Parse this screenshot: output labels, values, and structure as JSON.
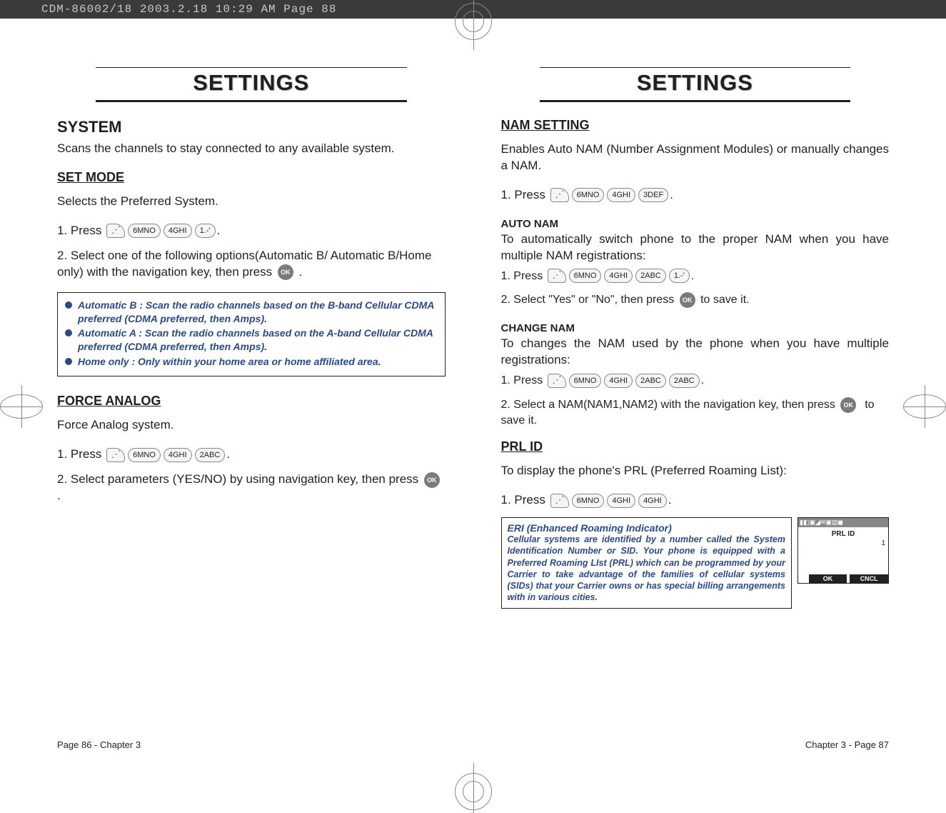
{
  "crop_bar": "CDM-86002/18  2003.2.18  10:29 AM  Page 88",
  "left": {
    "title": "SETTINGS",
    "h2": "SYSTEM",
    "intro": "Scans the channels to stay connected to any available system.",
    "setmode": {
      "heading": "SET MODE",
      "desc": "Selects the Preferred System."
    },
    "step1": {
      "pre": "1. Press",
      "post": "."
    },
    "step2": "2. Select one of the following options(Automatic B/ Automatic B/Home only) with the navigation key, then press",
    "step2_post": ".",
    "keys": {
      "k1": "6MNO",
      "k2": "4GHI",
      "k3": "1.-'"
    },
    "ok": "OK",
    "callout": {
      "b_label": "Automatic B :",
      "b_desc": "Scan the radio channels based on the B-band Cellular CDMA preferred (CDMA preferred, then Amps).",
      "a_label": "Automatic A :",
      "a_desc": "Scan the radio channels based on the A-band Cellular CDMA preferred (CDMA preferred, then Amps).",
      "h_label": "Home only :",
      "h_desc": "Only within your home area or home affiliated area."
    },
    "force": {
      "heading": "FORCE ANALOG",
      "desc": "Force Analog system."
    },
    "fstep1": {
      "pre": "1. Press",
      "post": "."
    },
    "fkeys": {
      "k1": "6MNO",
      "k2": "4GHI",
      "k3": "2ABC"
    },
    "fstep2": {
      "pre": "2. Select parameters (YES/NO) by using navigation key, then press",
      "post": "."
    },
    "footer": "Page 86 - Chapter 3"
  },
  "right": {
    "title": "SETTINGS",
    "nam": {
      "heading": "NAM SETTING",
      "desc": "Enables Auto NAM (Number Assignment Modules) or manually changes a NAM."
    },
    "nstep1": {
      "pre": "1. Press",
      "post": "."
    },
    "nkeys": {
      "k1": "6MNO",
      "k2": "4GHI",
      "k3": "3DEF"
    },
    "auto": {
      "heading": "AUTO NAM",
      "desc": "To automatically switch phone to the proper NAM when you have multiple NAM registrations:"
    },
    "astep1": {
      "pre": "1.  Press",
      "post": "."
    },
    "akeys": {
      "k1": "6MNO",
      "k2": "4GHI",
      "k3": "2ABC",
      "k4": "1.-'"
    },
    "astep2": {
      "pre": "2.  Select \"Yes\" or \"No\", then press",
      "post": "to save it."
    },
    "change": {
      "heading": "CHANGE NAM",
      "desc": "To changes the NAM used by the phone when you have multiple registrations:"
    },
    "cstep1": {
      "pre": "1.  Press",
      "post": "."
    },
    "ckeys": {
      "k1": "6MNO",
      "k2": "4GHI",
      "k3": "2ABC",
      "k4": "2ABC"
    },
    "cstep2": {
      "pre": "2.  Select a NAM(NAM1,NAM2) with the navigation key, then press",
      "post": "to save it."
    },
    "prl": {
      "heading": "PRL ID",
      "desc": "To display the phone's PRL (Preferred Roaming List):"
    },
    "pstep1": {
      "pre": "1. Press",
      "post": "."
    },
    "pkeys": {
      "k1": "6MNO",
      "k2": "4GHI",
      "k3": "4GHI"
    },
    "eri": {
      "title": "ERI (Enhanced Roaming Indicator)",
      "body": "Cellular systems are identified by a number called the System Identification Number or SID. Your phone is equipped with a Preferred Roaming LIst (PRL) which can be programmed by your Carrier to take advantage of the families of cellular systems (SIDs) that your Carrier owns or has special billing arrangements with in various cities."
    },
    "screen": {
      "bar_icons": "▮◧▣◢✉▣▤◼",
      "title": "PRL ID",
      "num": "1",
      "soft_ok": "OK",
      "soft_cncl": "CNCL"
    },
    "ok": "OK",
    "footer": "Chapter 3 - Page 87"
  }
}
